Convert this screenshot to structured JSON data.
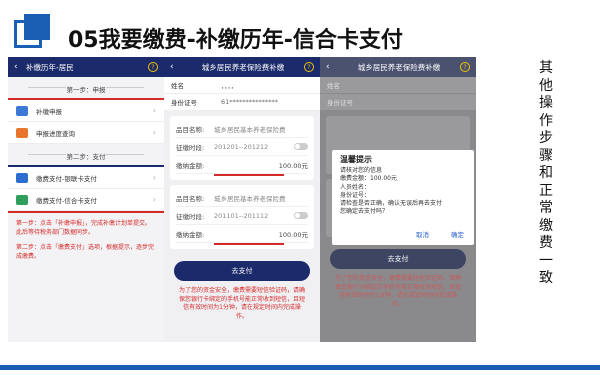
{
  "slide": {
    "title": "05我要缴费-补缴历年-信合卡支付",
    "side_note": "其他操作步骤和正常缴费一致",
    "accent_color": "#1a5fb4"
  },
  "phone1": {
    "appbar_title": "补缴历年-居民",
    "step1": "第一步：申报",
    "menu1": [
      {
        "label": "补缴申报",
        "icon": "doc-edit-icon",
        "color": "#3a79d6"
      },
      {
        "label": "申报进度查询",
        "icon": "progress-icon",
        "color": "#e8762d"
      }
    ],
    "step2": "第二步：支付",
    "menu2": [
      {
        "label": "缴费支付-银联卡支付",
        "icon": "unionpay-icon",
        "color": "#2d6fd0"
      },
      {
        "label": "缴费支付-信合卡支付",
        "icon": "rural-credit-icon",
        "color": "#2e9e5b"
      }
    ],
    "note1": "第一步：点击「补缴申报」，完成补缴计划单提交。此后等待税务部门数据同步。",
    "note2": "第二步：点击「缴费支付」选项，根据提示，逐步完成缴费。"
  },
  "phone2": {
    "appbar_title": "城乡居民养老保险费补缴",
    "name_label": "姓名",
    "name_value": "，，，，",
    "id_label": "身份证号",
    "id_value": "61***************",
    "cards": [
      {
        "item_label": "品目名称:",
        "item_value": "城乡居民基本养老保险费",
        "period_label": "征缴时段:",
        "period_value": "201201--201212",
        "amount_label": "缴纳金额:",
        "amount_value": "100.00元"
      },
      {
        "item_label": "品目名称:",
        "item_value": "城乡居民基本养老保险费",
        "period_label": "征缴时段:",
        "period_value": "201101--201112",
        "amount_label": "缴纳金额:",
        "amount_value": "100.00元"
      }
    ],
    "pay_button": "去支付",
    "tip": "为了您的资金安全，缴费需要短信验证码，请确保您银行卡绑定的手机号能正常收到短信，且短信有效时间为1分钟，请在规定时间内完成操作。"
  },
  "phone3": {
    "appbar_title": "城乡居民养老保险费补缴",
    "dialog": {
      "title": "温馨提示",
      "lines": [
        "请核对您的信息",
        "缴费金额：100.00元",
        "人员姓名：",
        "身份证号：",
        "请检查是否正确，确认无误后再去支付",
        "您确定去支付吗？"
      ],
      "cancel": "取消",
      "ok": "确定"
    }
  }
}
